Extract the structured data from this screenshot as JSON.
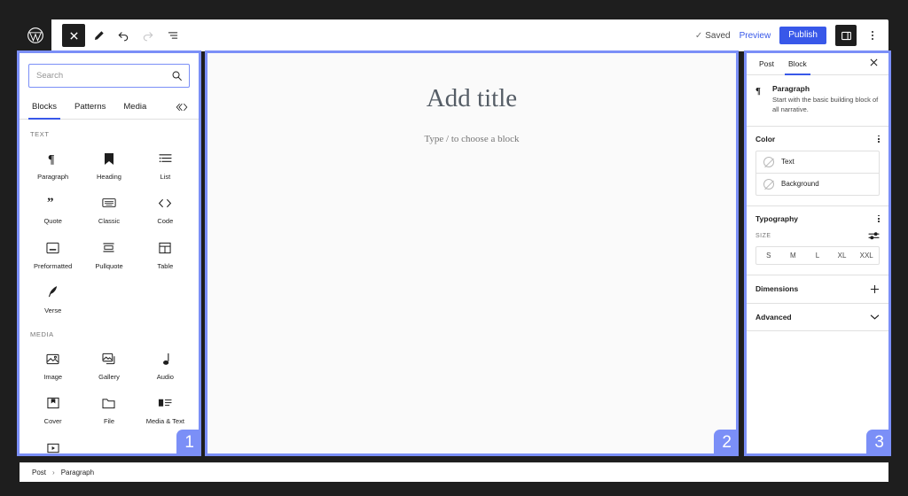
{
  "app": {
    "name": "WordPress Block Editor",
    "accent_blue": "#3858e9",
    "highlight_color": "#7b8ff7",
    "dark": "#1e1e1e"
  },
  "topbar": {
    "logo_icon": "wordpress-logo-icon",
    "tools": [
      {
        "name": "toggle-block-inserter",
        "icon": "close-x-icon",
        "state": "active"
      },
      {
        "name": "edit-tool",
        "icon": "pencil-icon",
        "state": "default"
      },
      {
        "name": "undo",
        "icon": "undo-arrow-icon",
        "state": "default"
      },
      {
        "name": "redo",
        "icon": "redo-arrow-icon",
        "state": "disabled"
      },
      {
        "name": "list-view",
        "icon": "list-view-icon",
        "state": "default"
      }
    ],
    "saved_label": "Saved",
    "saved_check": "✓",
    "preview_label": "Preview",
    "publish_label": "Publish",
    "sidebar_toggle_icon": "sidebar-panel-icon",
    "options_icon": "kebab-menu-icon"
  },
  "inserter": {
    "search": {
      "placeholder": "Search",
      "value": "",
      "icon": "search-icon"
    },
    "tabs": [
      {
        "label": "Blocks",
        "active": true
      },
      {
        "label": "Patterns",
        "active": false
      },
      {
        "label": "Media",
        "active": false
      }
    ],
    "tabs_trailing_icon": "reusable-blocks-icon",
    "sections": [
      {
        "label": "TEXT",
        "blocks": [
          {
            "label": "Paragraph",
            "icon": "paragraph-pilcrow-icon"
          },
          {
            "label": "Heading",
            "icon": "heading-bookmark-icon"
          },
          {
            "label": "List",
            "icon": "list-icon"
          },
          {
            "label": "Quote",
            "icon": "quote-marks-icon"
          },
          {
            "label": "Classic",
            "icon": "classic-editor-icon"
          },
          {
            "label": "Code",
            "icon": "code-brackets-icon"
          },
          {
            "label": "Preformatted",
            "icon": "preformatted-icon"
          },
          {
            "label": "Pullquote",
            "icon": "pullquote-icon"
          },
          {
            "label": "Table",
            "icon": "table-icon"
          },
          {
            "label": "Verse",
            "icon": "verse-quill-icon"
          }
        ]
      },
      {
        "label": "MEDIA",
        "blocks": [
          {
            "label": "Image",
            "icon": "image-icon"
          },
          {
            "label": "Gallery",
            "icon": "gallery-icon"
          },
          {
            "label": "Audio",
            "icon": "audio-note-icon"
          },
          {
            "label": "Cover",
            "icon": "cover-icon"
          },
          {
            "label": "File",
            "icon": "file-folder-icon"
          },
          {
            "label": "Media & Text",
            "icon": "media-and-text-icon"
          },
          {
            "label": "",
            "icon": "video-icon"
          }
        ]
      }
    ]
  },
  "canvas": {
    "title_placeholder": "Add title",
    "body_placeholder": "Type / to choose a block"
  },
  "settings": {
    "tabs": [
      {
        "label": "Post",
        "active": false
      },
      {
        "label": "Block",
        "active": true
      }
    ],
    "close_icon": "close-x-icon",
    "block_card": {
      "icon": "paragraph-pilcrow-icon",
      "title": "Paragraph",
      "description": "Start with the basic building block of all narrative."
    },
    "color_section": {
      "title": "Color",
      "options_icon": "kebab-menu-icon",
      "rows": [
        {
          "label": "Text",
          "swatch": "none"
        },
        {
          "label": "Background",
          "swatch": "none"
        }
      ]
    },
    "typography_section": {
      "title": "Typography",
      "options_icon": "kebab-menu-icon",
      "size_label": "SIZE",
      "size_control_icon": "settings-sliders-icon",
      "sizes": [
        "S",
        "M",
        "L",
        "XL",
        "XXL"
      ]
    },
    "dimensions_section": {
      "title": "Dimensions",
      "action_icon": "plus-icon"
    },
    "advanced_section": {
      "title": "Advanced",
      "action_icon": "chevron-down-icon"
    }
  },
  "breadcrumb": {
    "items": [
      "Post",
      "Paragraph"
    ],
    "separator": "›"
  },
  "annotations": [
    {
      "number": "1",
      "region": "block-inserter-panel"
    },
    {
      "number": "2",
      "region": "editor-canvas"
    },
    {
      "number": "3",
      "region": "settings-sidebar"
    }
  ]
}
